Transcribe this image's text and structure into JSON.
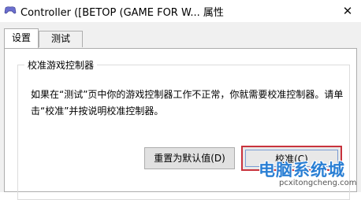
{
  "window": {
    "title": "Controller ([BETOP (GAME FOR W... 属性",
    "close_glyph": "✕"
  },
  "tabs": [
    {
      "label": "设置",
      "active": true
    },
    {
      "label": "测试",
      "active": false
    }
  ],
  "group": {
    "label": "校准游戏控制器",
    "description": "如果在“测试”页中你的游戏控制器工作不正常，你就需要校准控制器。请单击“校准”并按说明校准控制器。"
  },
  "buttons": {
    "reset_label": "重置为默认值(D)",
    "calibrate_label": "校准(C)"
  },
  "watermark": {
    "main": "电脑系统城",
    "sub": "pcxitongcheng.com"
  },
  "colors": {
    "highlight_border": "#c8323c",
    "watermark": "#2a7fd4"
  }
}
